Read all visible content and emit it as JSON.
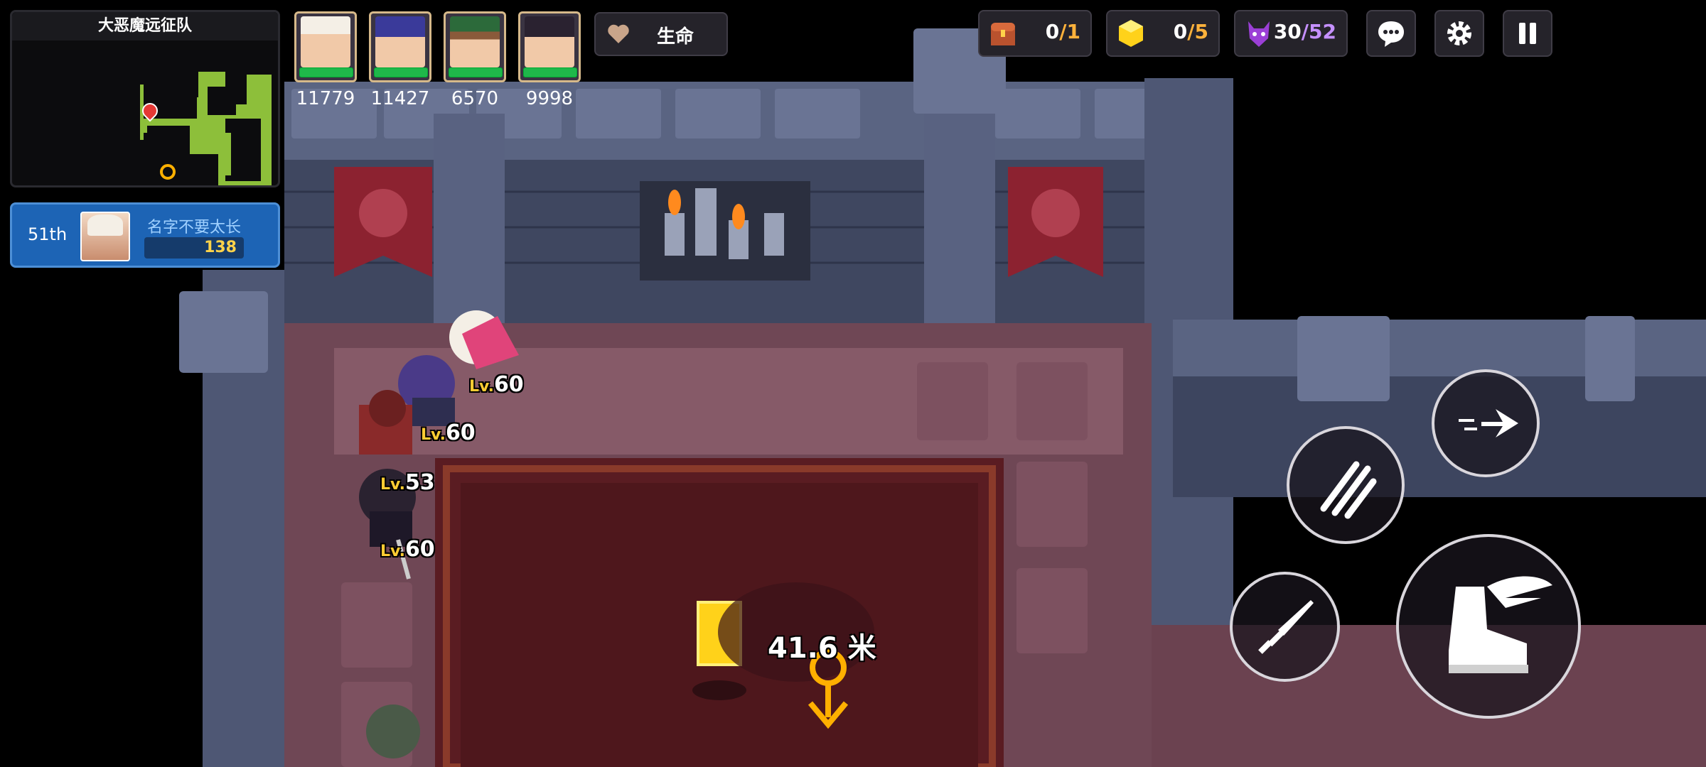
{
  "minimap": {
    "title": "大恶魔远征队"
  },
  "ranking": {
    "position": "51th",
    "name": "名字不要太长",
    "score": "138"
  },
  "party": [
    {
      "power": "11779",
      "level": "60"
    },
    {
      "power": "11427",
      "level": "60"
    },
    {
      "power": "6570",
      "level": "53"
    },
    {
      "power": "9998",
      "level": "60"
    }
  ],
  "life_button": {
    "label": "生命"
  },
  "counters": {
    "chest": {
      "current": "0",
      "max": "/1"
    },
    "gold_cube": {
      "current": "0",
      "max": "/5"
    },
    "monster": {
      "current": "30",
      "max": "/52"
    }
  },
  "objective": {
    "distance": "41.6 米"
  },
  "icons": {
    "heart": "heart-icon",
    "chest": "treasure-chest-icon",
    "cube": "gold-cube-icon",
    "monster": "demon-icon",
    "chat": "chat-icon",
    "settings": "gear-icon",
    "pause": "pause-icon",
    "dash": "dash-arrow-icon",
    "claw": "claw-skill-icon",
    "sword": "sword-attack-icon",
    "boot": "winged-boot-icon"
  },
  "colors": {
    "hp_bar": "#1fb84a",
    "rank_panel": "#1d64b5",
    "counter_max": "#ffb23b",
    "monster_max": "#c590ff"
  }
}
